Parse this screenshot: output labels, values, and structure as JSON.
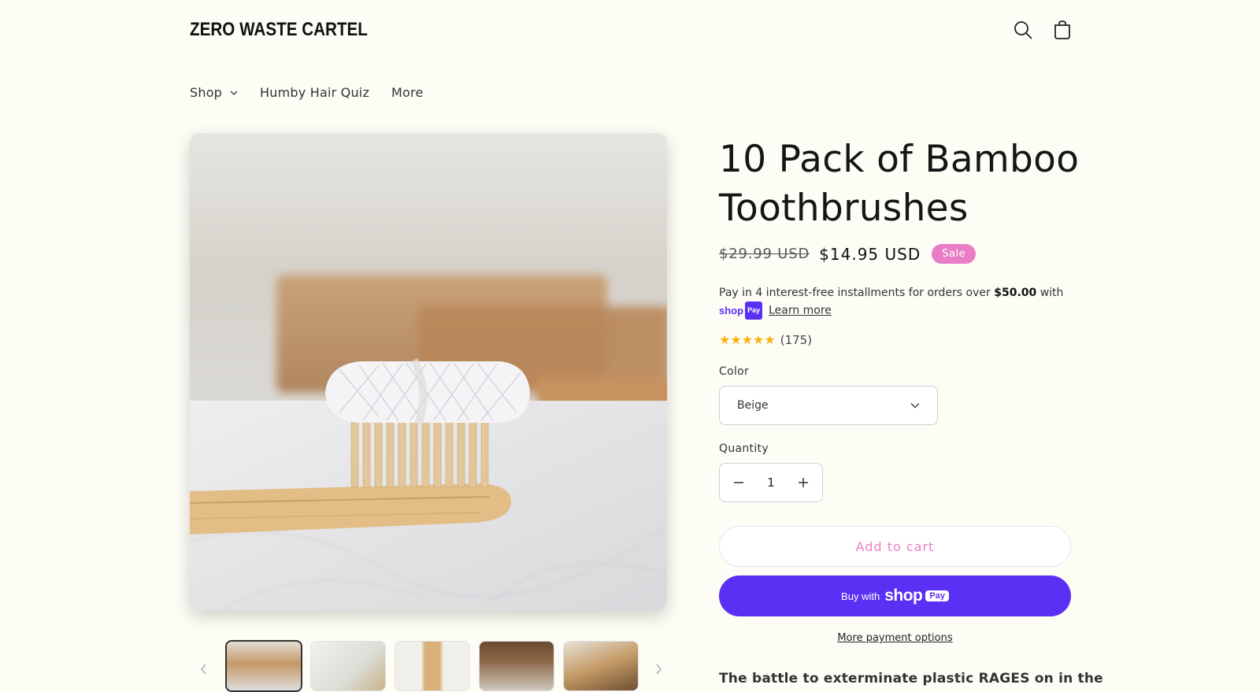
{
  "header": {
    "logo": "ZERO WASTE CARTEL",
    "search_icon": "search-icon",
    "cart_icon": "cart-icon"
  },
  "nav": {
    "items": [
      {
        "label": "Shop",
        "has_dropdown": true
      },
      {
        "label": "Humby Hair Quiz",
        "has_dropdown": false
      },
      {
        "label": "More",
        "has_dropdown": false
      }
    ]
  },
  "gallery": {
    "main_image": "bamboo-toothbrush-with-floss-photo",
    "thumbnails": [
      "toothbrush-floss-thumb",
      "floss-set-thumb",
      "packaging-thumb",
      "jar-of-toothbrushes-thumb",
      "row-of-toothbrushes-thumb"
    ],
    "active_thumbnail": 0
  },
  "product": {
    "title": "10 Pack of Bamboo Toothbrushes",
    "price_old": "$29.99 USD",
    "price_new": "$14.95 USD",
    "sale_badge": "Sale",
    "installments_text": "Pay in 4 interest-free installments for orders over ",
    "installments_amount": "$50.00",
    "installments_suffix": " with",
    "shop_word": "shop",
    "pay_word": "Pay",
    "learn_more": "Learn more",
    "rating_count": "(175)",
    "rating_stars": 5,
    "color_label": "Color",
    "color_value": "Beige",
    "quantity_label": "Quantity",
    "quantity_value": "1",
    "add_to_cart": "Add to cart",
    "buy_with": "Buy with",
    "shop_pay_shop": "shop",
    "shop_pay_pay": "Pay",
    "more_payment_options": "More payment options",
    "description_start": "The battle to exterminate plastic RAGES on in the"
  },
  "colors": {
    "background": "#fdfcf5",
    "sale_pink": "#e97ec6",
    "shop_pay_purple": "#5a31f4",
    "star_gold": "#f5b50a"
  }
}
